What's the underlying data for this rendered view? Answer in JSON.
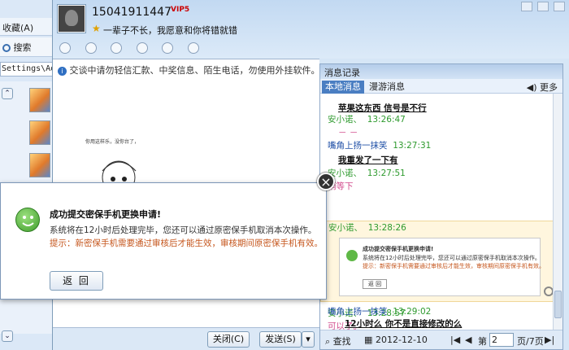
{
  "explorer": {
    "fav_label": "收藏(A)",
    "search_label": "搜索",
    "address_text": "Settings\\Adm"
  },
  "contact": {
    "name": "15041911447",
    "badge": "VIP5",
    "signature": "一辈子不长，我愿意和你将错就错"
  },
  "chat": {
    "warning": "交谈中请勿轻信汇款、中奖信息、陌生电话，勿使用外挂软件。",
    "sketch_caption": "你用这样乐，没你台了，",
    "close_btn": "关闭(C)",
    "send_btn": "发送(S)"
  },
  "history": {
    "title": "消息记录",
    "tab_local": "本地消息",
    "tab_roam": "漫游消息",
    "more": "更多",
    "messages": [
      {
        "text": "苹果这东西 信号是不行"
      },
      {
        "name": "安小诺、",
        "time": "13:26:47"
      },
      {
        "text": "－ －"
      },
      {
        "name": "嘴角上扬一抹笑",
        "time": "13:27:31"
      },
      {
        "text": "我重发了一下有"
      },
      {
        "name": "安小诺、",
        "time": "13:27:51"
      },
      {
        "text": "稍等下"
      },
      {
        "name": "安小诺、",
        "time": "13:28:26"
      },
      {
        "name": "安小诺、",
        "time": "13:28:57"
      },
      {
        "text": "可以了。"
      },
      {
        "name": "嘴角上扬一抹笑",
        "time": "13:29:02"
      },
      {
        "text": "12小时么   你不是直接修改的么"
      }
    ],
    "mini_dialog": {
      "title": "成功提交密保手机更换申请!",
      "line1": "系统将在12小时后处理完毕，您还可以通过原密保手机取消本次操作。",
      "line2": "提示：新密保手机需要通过审核后才能生效，审核期间原密保手机有效。",
      "button": "返 回"
    },
    "footer": {
      "search": "查找",
      "date": "2012-12-10",
      "page_prefix": "第",
      "page_value": "2",
      "page_suffix": "页/7页"
    }
  },
  "dialog": {
    "title": "成功提交密保手机更换申请!",
    "line1": "系统将在12小时后处理完毕，您还可以通过原密保手机取消本次操作。",
    "line2": "提示：新密保手机需要通过审核后才能生效，审核期间原密保手机有效。",
    "back_btn": "返 回"
  }
}
